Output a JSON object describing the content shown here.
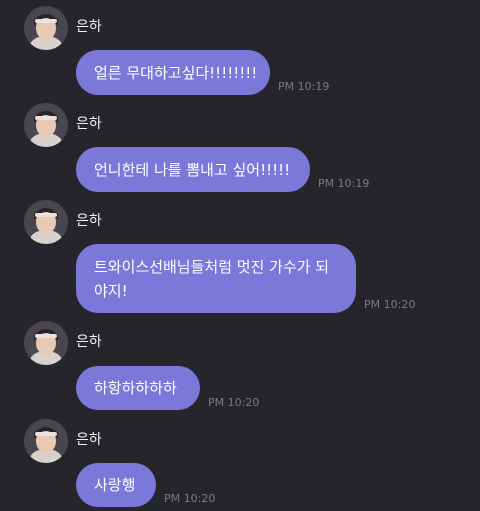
{
  "chat": {
    "messages": [
      {
        "sender": "은하",
        "text": "얼른 무대하고싶다!!!!!!!!",
        "time": "PM 10:19"
      },
      {
        "sender": "은하",
        "text": "언니한테 나를 뽐내고 싶어!!!!!",
        "time": "PM 10:19"
      },
      {
        "sender": "은하",
        "text": "트와이스선배님들처럼 멋진 가수가 되야지!",
        "time": "PM 10:20"
      },
      {
        "sender": "은하",
        "text": "하항하하하하",
        "time": "PM 10:20"
      },
      {
        "sender": "은하",
        "text": "사랑행",
        "time": "PM 10:20"
      }
    ]
  },
  "colors": {
    "background": "#25252b",
    "bubble": "#7b78d9",
    "timestamp": "#7a7a86"
  },
  "icons": {
    "avatar": "user-avatar-icon"
  }
}
